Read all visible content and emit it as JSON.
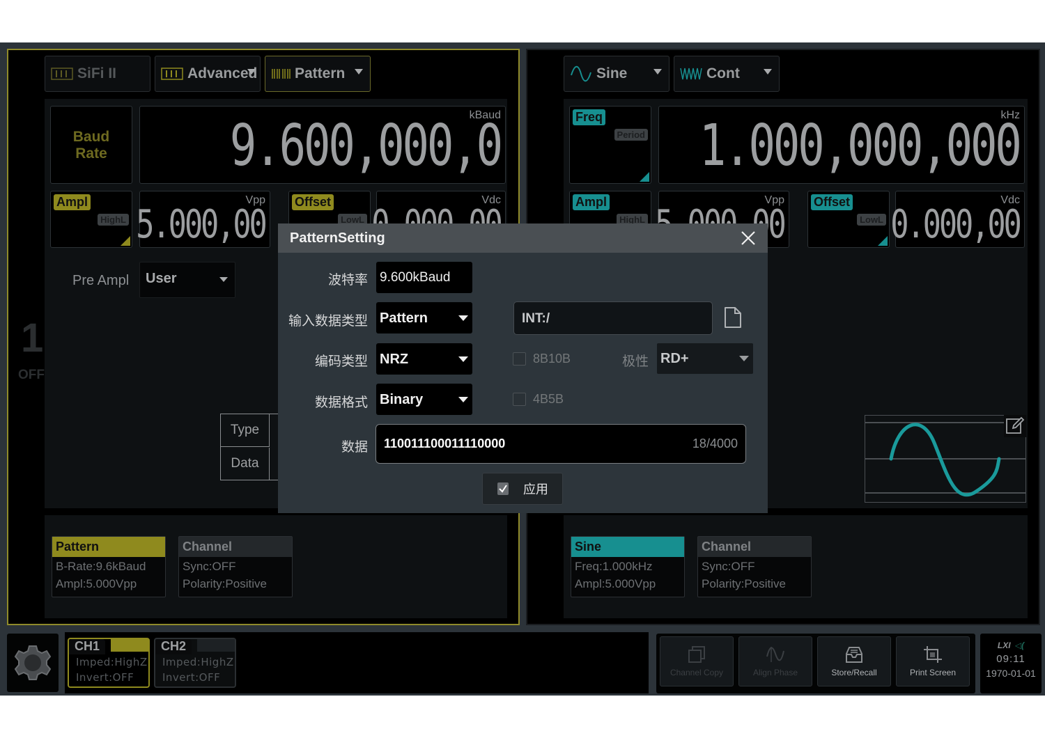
{
  "ch1": {
    "side_number": "1",
    "side_state": "OFF",
    "wave_buttons": [
      {
        "label": "SiFi II",
        "icon": "sifi-icon"
      },
      {
        "label": "Advanced",
        "icon": "sifi-icon"
      },
      {
        "label": "Pattern",
        "icon": "pattern-icon"
      }
    ],
    "baud": {
      "label_line1": "Baud",
      "label_line2": "Rate",
      "unit": "kBaud",
      "value": "9.600,000,0"
    },
    "ampl": {
      "tag": "Ampl",
      "sub_tag": "HighL",
      "unit": "Vpp",
      "value": "5.000,00"
    },
    "offset": {
      "tag": "Offset",
      "sub_tag": "LowL",
      "unit": "Vdc",
      "value": "0.000,00"
    },
    "pre_ampl": {
      "label": "Pre Ampl",
      "value": "User"
    },
    "table": {
      "rows": [
        "Type",
        "Data"
      ]
    },
    "cards": [
      {
        "head": "Pattern",
        "lines": [
          "B-Rate:9.6kBaud",
          "Ampl:5.000Vpp"
        ]
      },
      {
        "head": "Channel",
        "lines": [
          "Sync:OFF",
          "Polarity:Positive"
        ]
      }
    ]
  },
  "ch2": {
    "wave_buttons": [
      {
        "label": "Sine",
        "icon": "sine-icon"
      },
      {
        "label": "Cont",
        "icon": "cont-icon"
      }
    ],
    "freq": {
      "tag": "Freq",
      "sub_tag": "Period",
      "unit": "kHz",
      "value": "1.000,000,000"
    },
    "ampl": {
      "tag": "Ampl",
      "sub_tag": "HighL",
      "unit": "Vpp",
      "value": "5.000,00"
    },
    "offset": {
      "tag": "Offset",
      "sub_tag": "LowL",
      "unit": "Vdc",
      "value": "0.000,00"
    },
    "cards": [
      {
        "head": "Sine",
        "lines": [
          "Freq:1.000kHz",
          "Ampl:5.000Vpp"
        ]
      },
      {
        "head": "Channel",
        "lines": [
          "Sync:OFF",
          "Polarity:Positive"
        ]
      }
    ]
  },
  "dialog": {
    "title": "PatternSetting",
    "baud_label": "波特率",
    "baud_value": "9.600kBaud",
    "input_type_label": "输入数据类型",
    "input_type_value": "Pattern",
    "path_value": "INT:/",
    "encoding_label": "编码类型",
    "encoding_value": "NRZ",
    "chk_8b10b": {
      "label": "8B10B",
      "checked": false
    },
    "polarity_label": "极性",
    "polarity_value": "RD+",
    "format_label": "数据格式",
    "format_value": "Binary",
    "chk_4b5b": {
      "label": "4B5B",
      "checked": false
    },
    "data_label": "数据",
    "data_value": "110011100011110000",
    "data_count": "18/4000",
    "apply_label": "应用"
  },
  "bottom": {
    "ch_tabs": [
      {
        "name": "CH1",
        "imped": "Imped:HighZ",
        "invert": "Invert:OFF",
        "active": true
      },
      {
        "name": "CH2",
        "imped": "Imped:HighZ",
        "invert": "Invert:OFF",
        "active": false
      }
    ],
    "tools": [
      {
        "label": "Channel Copy",
        "enabled": false
      },
      {
        "label": "Align Phase",
        "enabled": false
      },
      {
        "label": "Store/Recall",
        "enabled": true
      },
      {
        "label": "Print Screen",
        "enabled": true
      }
    ],
    "status": {
      "lxi": "LXI",
      "time": "09:11",
      "date": "1970-01-01"
    }
  },
  "colors": {
    "ch1_accent": "#8f8a1e",
    "ch2_accent": "#178f90"
  }
}
